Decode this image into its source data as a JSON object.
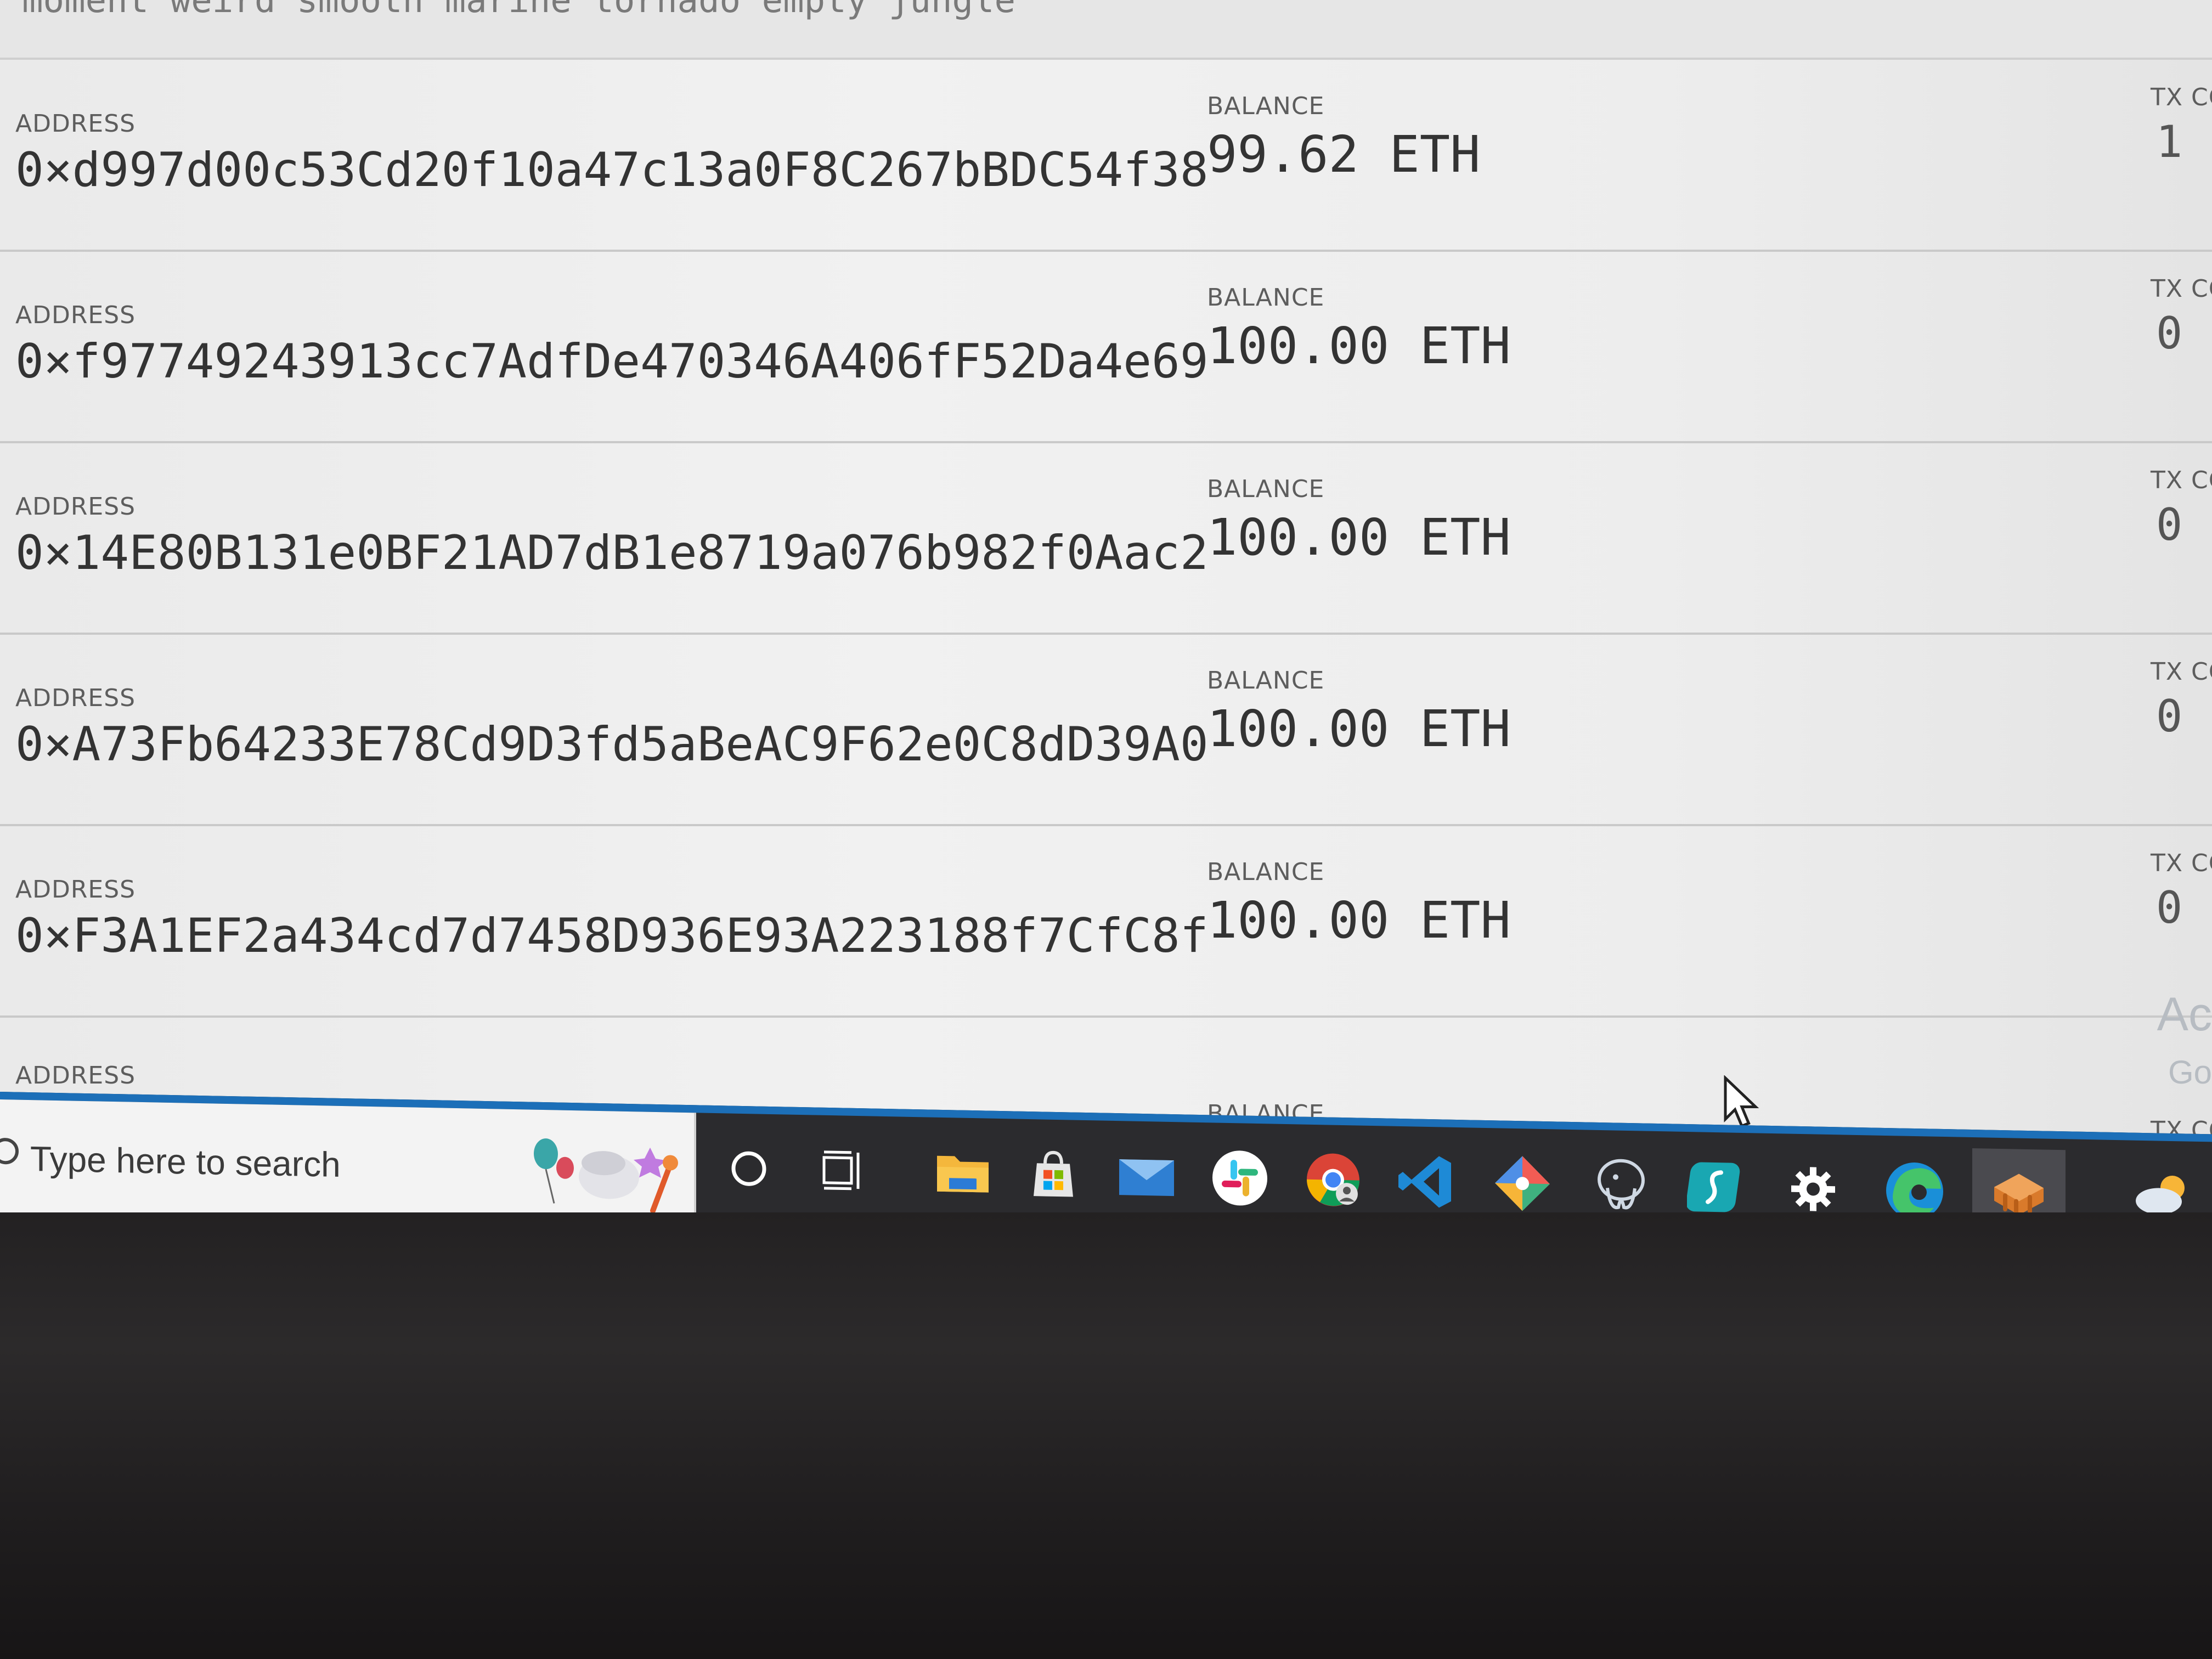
{
  "mnemonic": {
    "text": "moment weird smooth marine tornado empty jungle"
  },
  "labels": {
    "address": "ADDRESS",
    "balance": "BALANCE",
    "tx_count": "TX CO"
  },
  "accounts": [
    {
      "address": "0×d997d00c53Cd20f10a47c13a0F8C267bBDC54f38",
      "balance": "99.62  ETH",
      "tx_count": "1"
    },
    {
      "address": "0×f97749243913cc7AdfDe470346A406fF52Da4e69",
      "balance": "100.00  ETH",
      "tx_count": "0"
    },
    {
      "address": "0×14E80B131e0BF21AD7dB1e8719a076b982f0Aac2",
      "balance": "100.00  ETH",
      "tx_count": "0"
    },
    {
      "address": "0×A73Fb64233E78Cd9D3fd5aBeAC9F62e0C8dD39A0",
      "balance": "100.00  ETH",
      "tx_count": "0"
    },
    {
      "address": "0×F3A1EF2a434cd7d7458D936E93A223188f7CfC8f",
      "balance": "100.00  ETH",
      "tx_count": "0"
    },
    {
      "address": "",
      "balance": "",
      "tx_count": ""
    }
  ],
  "watermark": {
    "line1": "Ac",
    "line2": "Go"
  },
  "taskbar": {
    "search_placeholder": "Type here to search",
    "icons": [
      "cortana-icon",
      "task-view-icon",
      "file-explorer-icon",
      "microsoft-store-icon",
      "mail-icon",
      "slack-icon",
      "chrome-icon",
      "vscode-icon",
      "git-kraken-icon",
      "pgadmin-icon",
      "sourcetree-icon",
      "settings-icon",
      "edge-icon",
      "ganache-icon",
      "weather-icon"
    ],
    "accent_color": "#1c6fb8"
  }
}
